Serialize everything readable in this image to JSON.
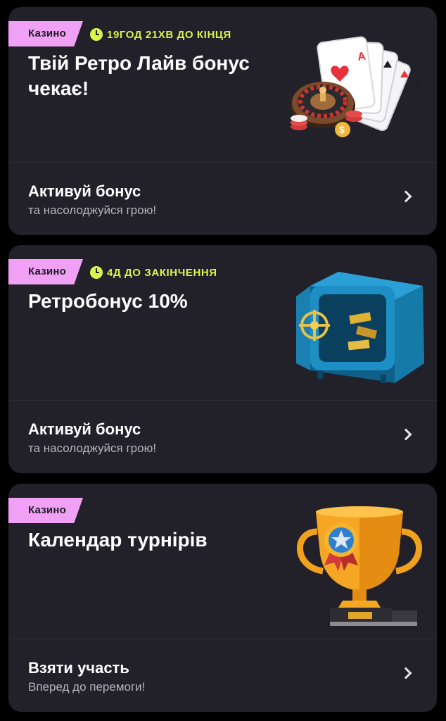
{
  "cards": [
    {
      "tag": "Казино",
      "timer": "19ГОД 21ХВ ДО КІНЦЯ",
      "title": "Твій Ретро Лайв бонус чекає!",
      "cta_title": "Активуй бонус",
      "cta_subtitle": "та насолоджуйся грою!",
      "icon": "roulette-cards-icon"
    },
    {
      "tag": "Казино",
      "timer": "4Д ДО ЗАКІНЧЕННЯ",
      "title": "Ретробонус 10%",
      "cta_title": "Активуй бонус",
      "cta_subtitle": "та насолоджуйся грою!",
      "icon": "safe-icon"
    },
    {
      "tag": "Казино",
      "timer": "",
      "title": "Календар турнірів",
      "cta_title": "Взяти участь",
      "cta_subtitle": "Вперед до перемоги!",
      "icon": "trophy-icon"
    }
  ],
  "colors": {
    "background": "#000000",
    "card": "#22212a",
    "tag": "#f0a1f5",
    "timer": "#d8f54a"
  }
}
